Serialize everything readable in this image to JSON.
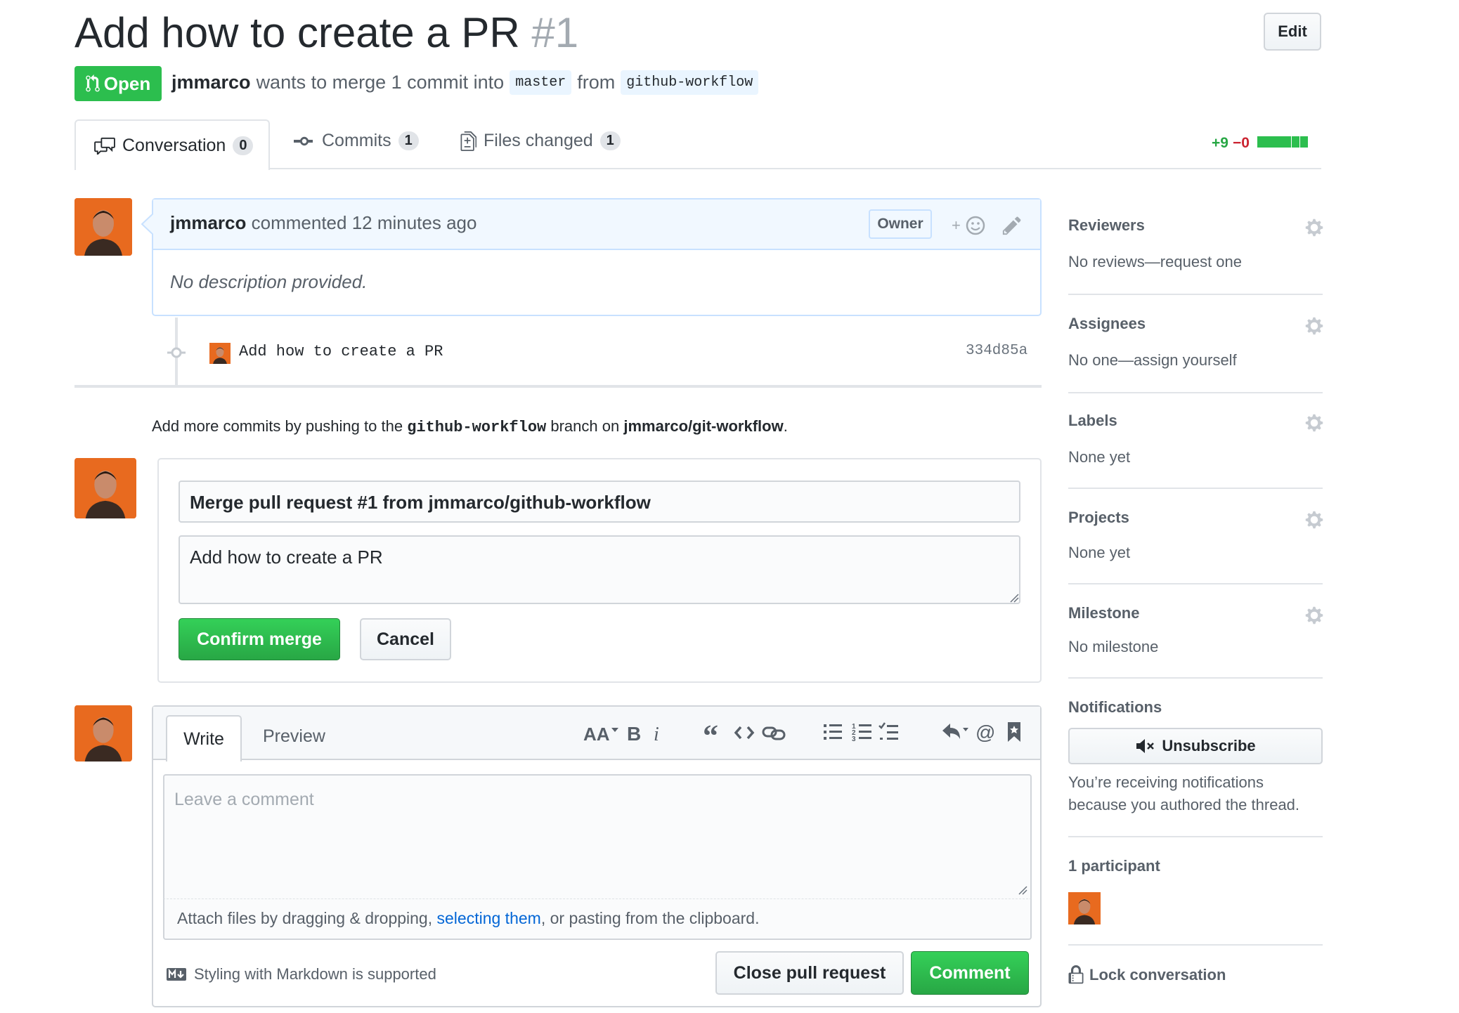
{
  "header": {
    "title": "Add how to create a PR",
    "number": "#1",
    "edit_label": "Edit",
    "state": "Open",
    "author": "jmmarco",
    "merge_text": "wants to merge 1 commit into",
    "base_branch": "master",
    "from_text": "from",
    "head_branch": "github-workflow"
  },
  "tabs": {
    "conversation": {
      "label": "Conversation",
      "count": "0"
    },
    "commits": {
      "label": "Commits",
      "count": "1"
    },
    "files": {
      "label": "Files changed",
      "count": "1"
    }
  },
  "diffstat": {
    "additions": "+9",
    "deletions": "−0",
    "blocks_added": 5,
    "blocks_total": 5
  },
  "comment": {
    "author": "jmmarco",
    "action": "commented 12 minutes ago",
    "badge": "Owner",
    "body": "No description provided."
  },
  "commit": {
    "message": "Add how to create a PR",
    "sha": "334d85a"
  },
  "push_hint": {
    "prefix": "Add more commits by pushing to the",
    "branch": "github-workflow",
    "middle": "branch on",
    "repo": "jmmarco/git-workflow",
    "suffix": "."
  },
  "merge": {
    "title_value": "Merge pull request #1 from jmmarco/github-workflow",
    "message_value": "Add how to create a PR",
    "confirm_label": "Confirm merge",
    "cancel_label": "Cancel"
  },
  "form": {
    "write_tab": "Write",
    "preview_tab": "Preview",
    "toolbar": [
      "header-icon",
      "bold-icon",
      "italic-icon",
      "quote-icon",
      "code-icon",
      "link-icon",
      "bullet-list-icon",
      "numbered-list-icon",
      "task-list-icon",
      "reply-icon",
      "mention-icon",
      "bookmark-icon"
    ],
    "placeholder": "Leave a comment",
    "attach_prefix": "Attach files by dragging & dropping,",
    "attach_link": "selecting them",
    "attach_suffix": ", or pasting from the clipboard.",
    "markdown_hint": "Styling with Markdown is supported",
    "close_label": "Close pull request",
    "comment_label": "Comment"
  },
  "sidebar": {
    "reviewers": {
      "heading": "Reviewers",
      "value": "No reviews—request one"
    },
    "assignees": {
      "heading": "Assignees",
      "value": "No one—assign yourself"
    },
    "labels": {
      "heading": "Labels",
      "value": "None yet"
    },
    "projects": {
      "heading": "Projects",
      "value": "None yet"
    },
    "milestone": {
      "heading": "Milestone",
      "value": "No milestone"
    },
    "notifications": {
      "heading": "Notifications",
      "button": "Unsubscribe",
      "reason": "You’re receiving notifications because you authored the thread."
    },
    "participants": {
      "heading": "1 participant"
    },
    "lock": "Lock conversation"
  },
  "colors": {
    "green": "#2cbe4e",
    "blue_link": "#0366d6",
    "avatar": "#e86a1f"
  }
}
